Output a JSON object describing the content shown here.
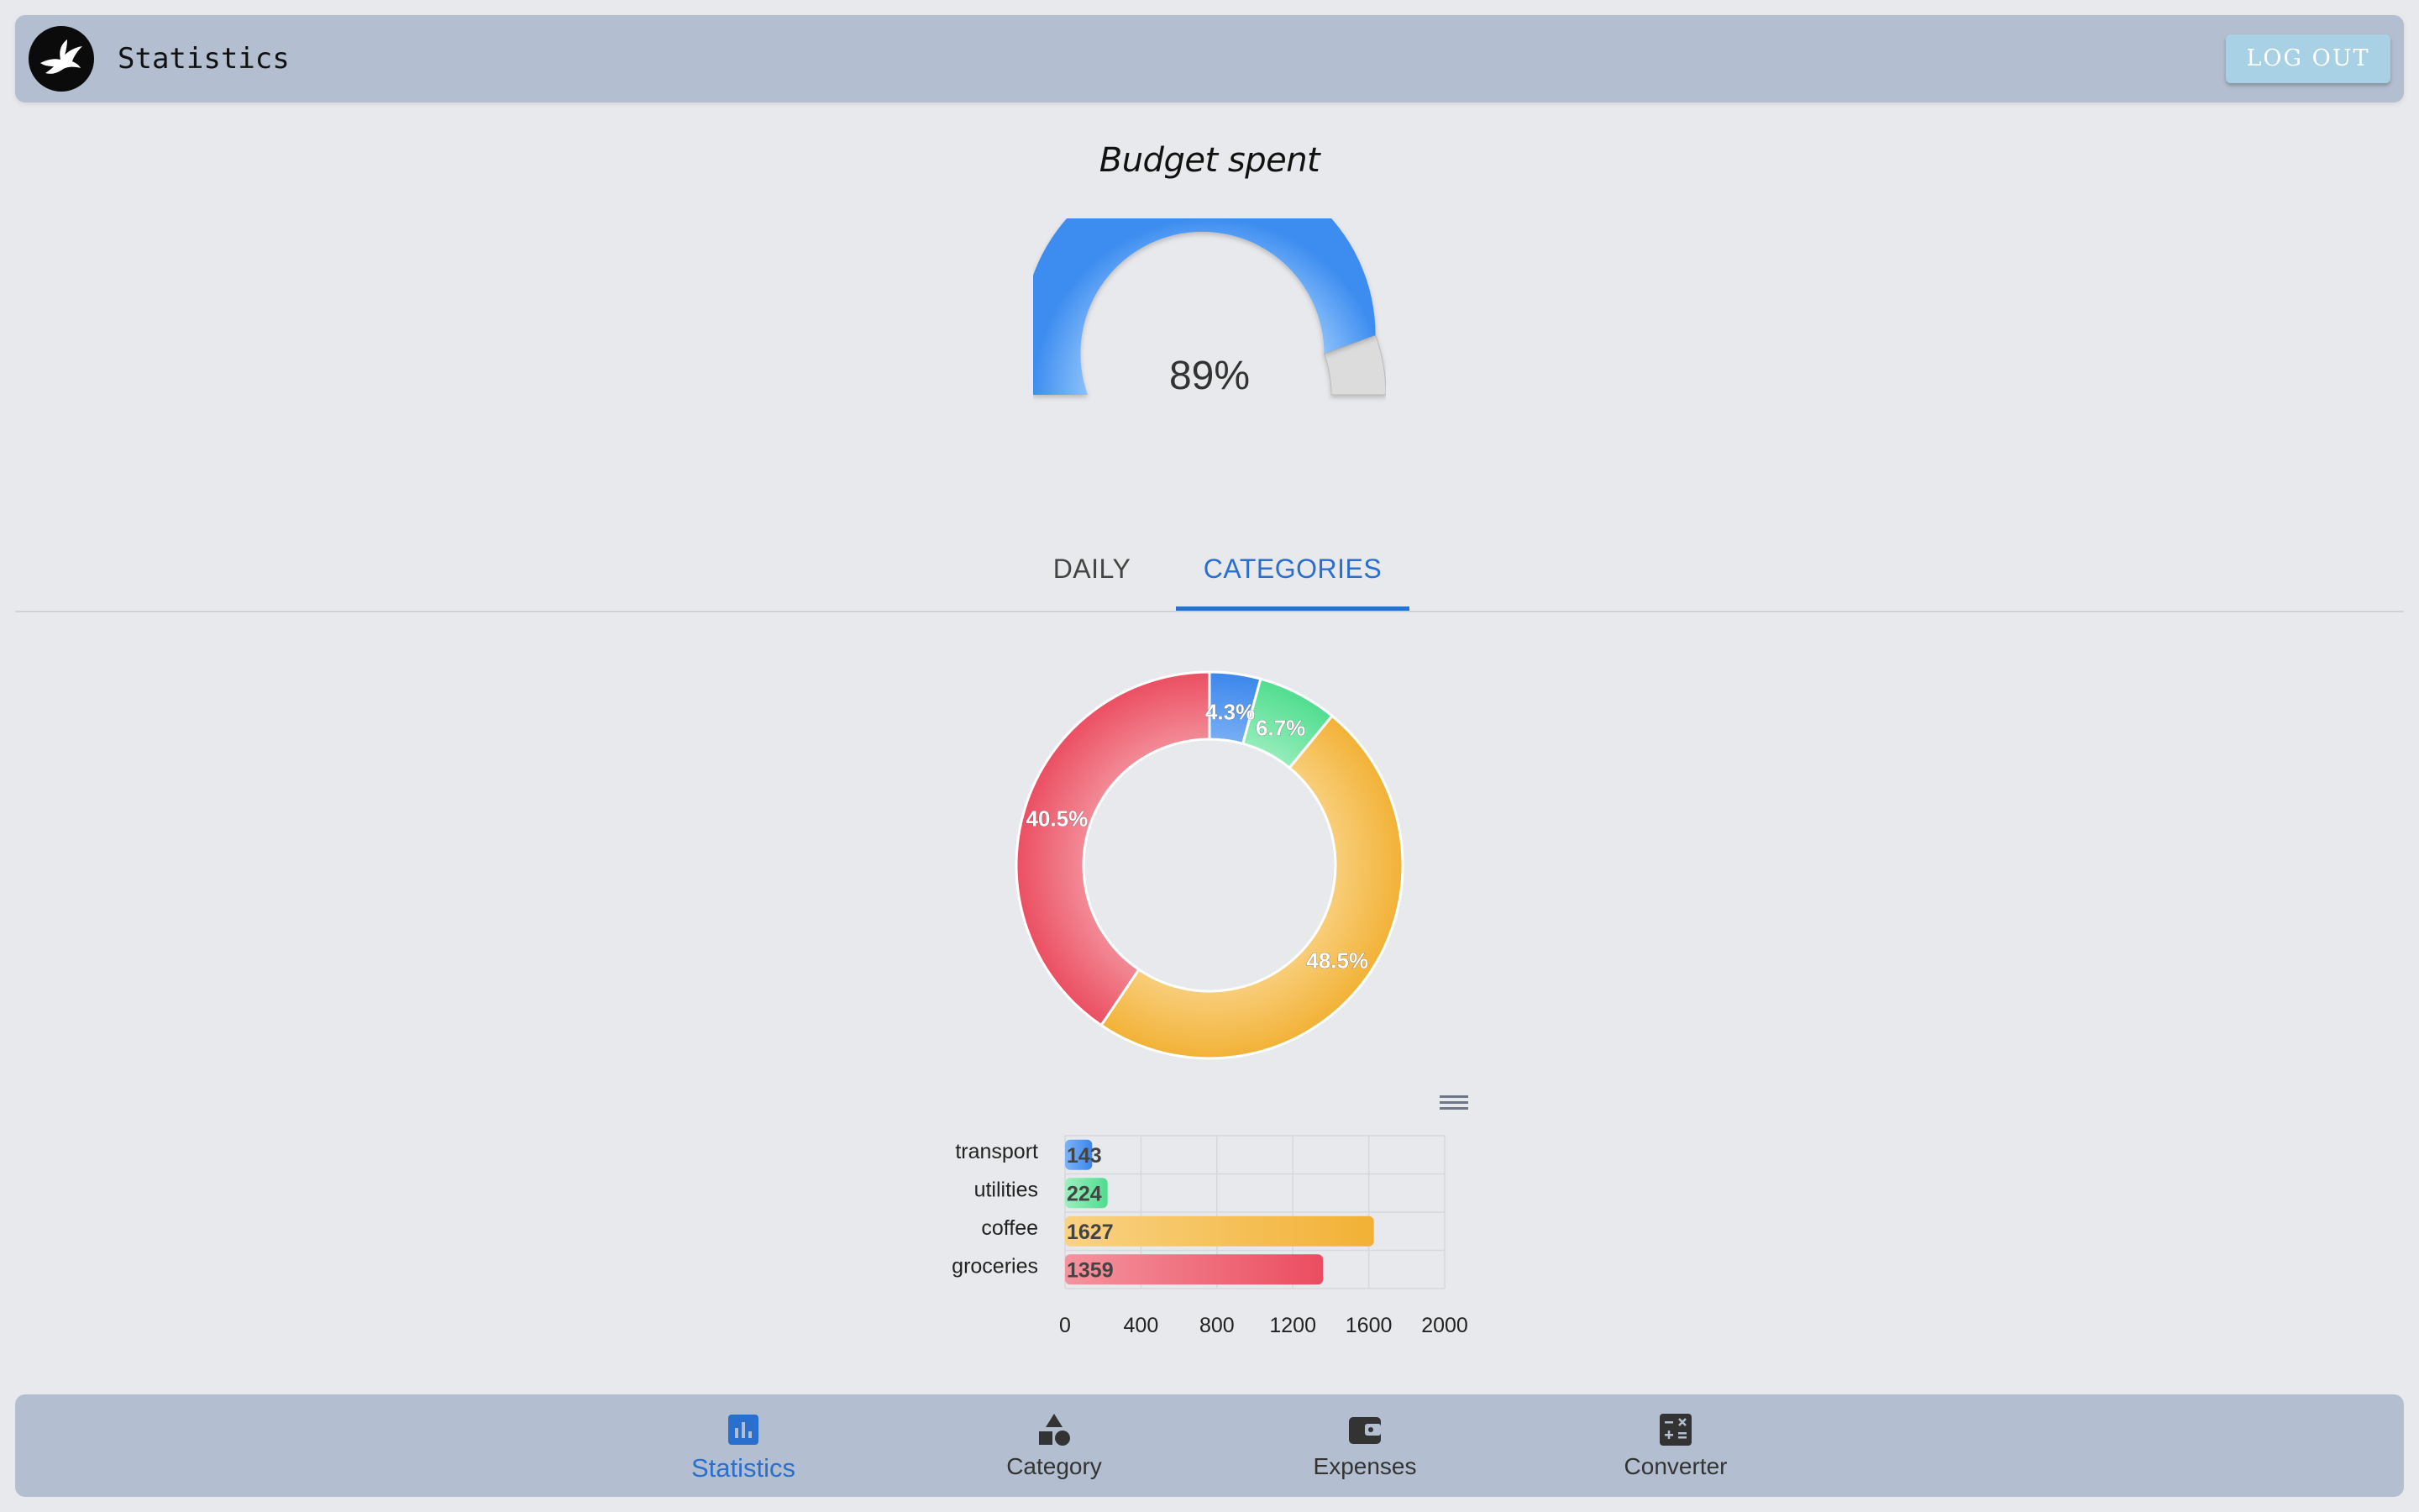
{
  "header": {
    "logo_icon": "hummingbird-logo-icon",
    "title": "Statistics",
    "logout_label": "LOG OUT"
  },
  "gauge": {
    "title": "Budget spent",
    "value_label": "89%",
    "value": 0.89,
    "fill_color": "#3d8df0",
    "track_color": "#dcdcdc"
  },
  "tabs": [
    {
      "label": "DAILY",
      "active": false
    },
    {
      "label": "CATEGORIES",
      "active": true
    }
  ],
  "chart_data": [
    {
      "type": "pie",
      "variant": "donut",
      "labels": [
        "transport",
        "utilities",
        "coffee",
        "groceries"
      ],
      "values": [
        143,
        224,
        1627,
        1359
      ],
      "percent_labels": [
        "4.3%",
        "6.7%",
        "48.5%",
        "40.5%"
      ],
      "colors": [
        "#3a86ec",
        "#4fdd8e",
        "#f2b135",
        "#eb4d60"
      ]
    },
    {
      "type": "bar",
      "orientation": "horizontal",
      "categories": [
        "transport",
        "utilities",
        "coffee",
        "groceries"
      ],
      "values": [
        143,
        224,
        1627,
        1359
      ],
      "colors": [
        "#3a86ec",
        "#4fdd8e",
        "#f2b135",
        "#eb4d60"
      ],
      "x_ticks": [
        "0",
        "400",
        "800",
        "1200",
        "1600",
        "2000"
      ],
      "xlim": [
        0,
        2000
      ],
      "grid": true,
      "menu_icon": "hamburger-menu-icon"
    }
  ],
  "bottom_nav": [
    {
      "label": "Statistics",
      "icon": "bar-chart-icon",
      "active": true
    },
    {
      "label": "Category",
      "icon": "shapes-icon",
      "active": false
    },
    {
      "label": "Expenses",
      "icon": "wallet-icon",
      "active": false
    },
    {
      "label": "Converter",
      "icon": "calculator-icon",
      "active": false
    }
  ]
}
